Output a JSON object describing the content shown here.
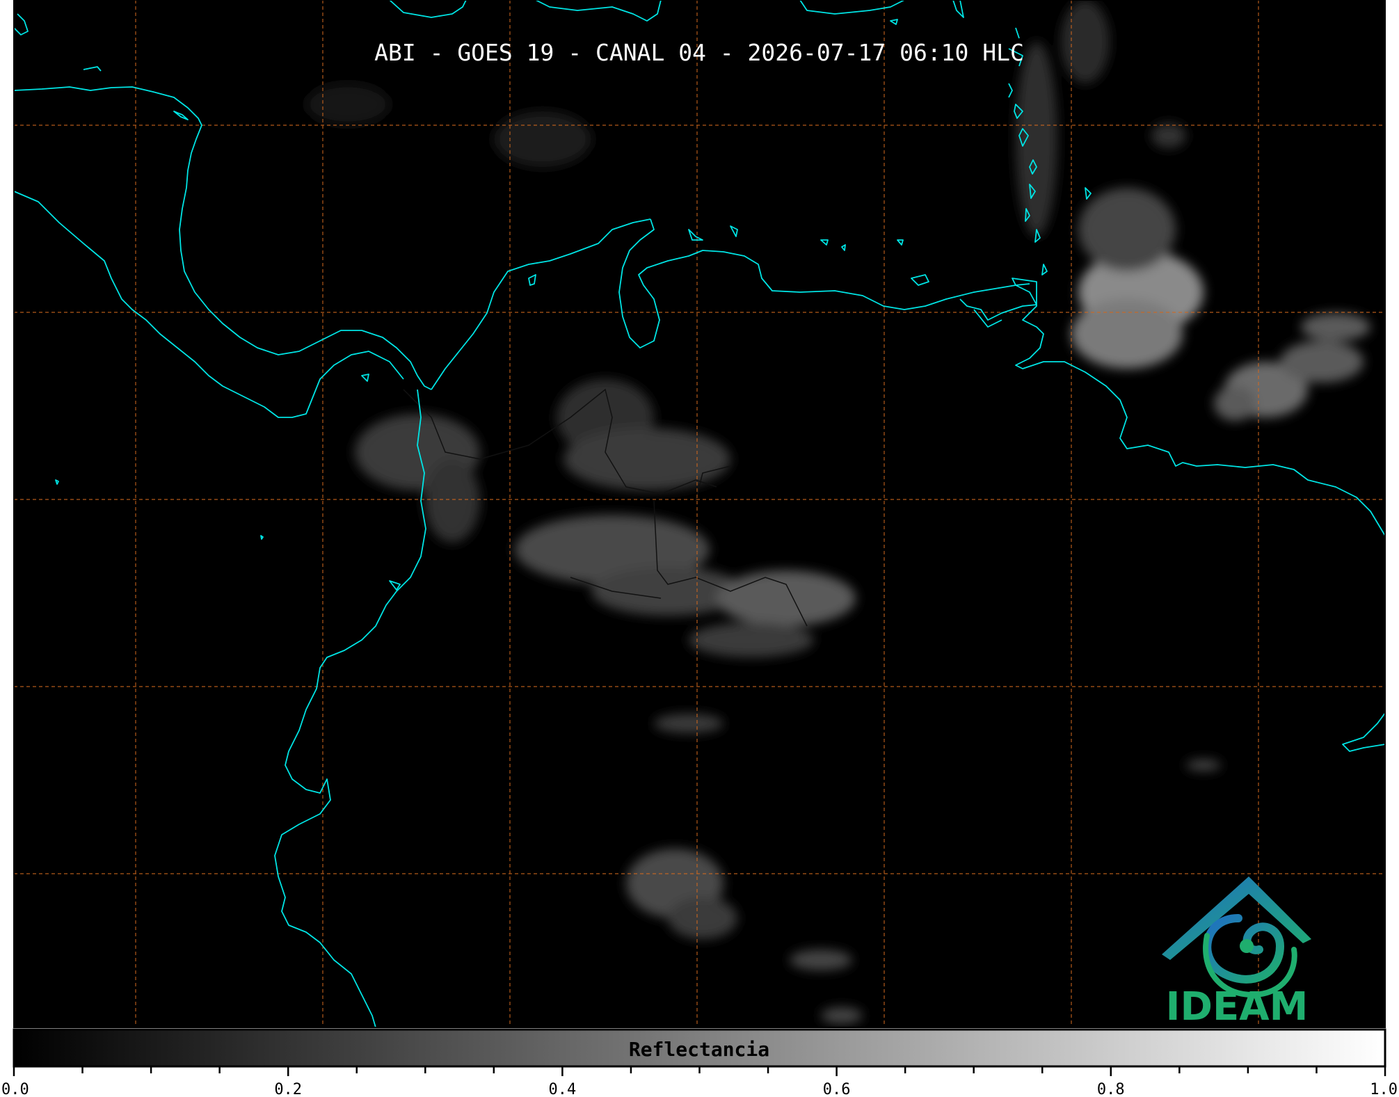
{
  "title": "ABI - GOES 19 - CANAL 04 - 2026-07-17 06:10 HLC",
  "logo": {
    "text": "IDEAM",
    "icon": "ideam-logo-icon"
  },
  "colorbar": {
    "label": "Reflectancia",
    "ticks": [
      "0.0",
      "0.2",
      "0.4",
      "0.6",
      "0.8",
      "1.0"
    ],
    "min": 0.0,
    "max": 1.0,
    "color_low": "#000000",
    "color_high": "#ffffff"
  },
  "colors": {
    "coastline": "#00e5e5",
    "gridline": "#d2691e",
    "borders": "#000000",
    "background": "#000000",
    "logo_green": "#1fae6e",
    "logo_blue": "#1f6fc4"
  }
}
